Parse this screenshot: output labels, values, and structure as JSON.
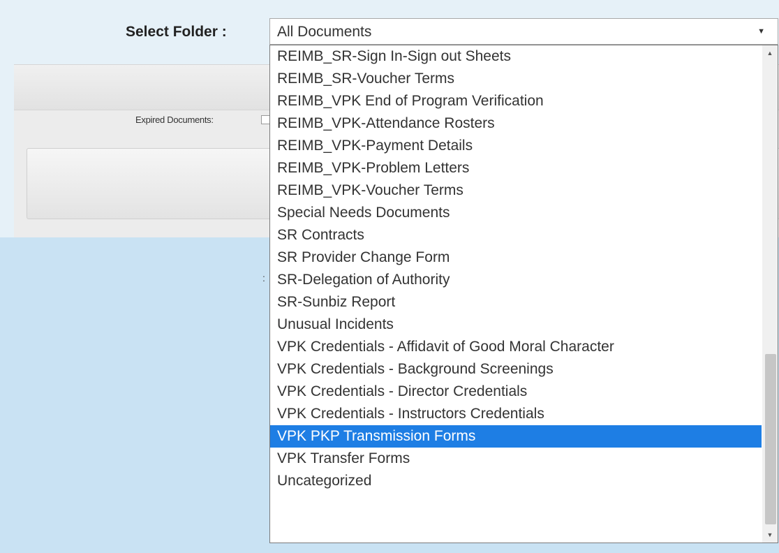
{
  "folder_selector": {
    "label": "Select Folder :",
    "value": "All Documents",
    "options": [
      "REIMB_SR-Sign In-Sign out Sheets",
      "REIMB_SR-Voucher Terms",
      "REIMB_VPK End of Program Verification",
      "REIMB_VPK-Attendance Rosters",
      "REIMB_VPK-Payment Details",
      "REIMB_VPK-Problem Letters",
      "REIMB_VPK-Voucher Terms",
      "Special Needs Documents",
      "SR Contracts",
      "SR Provider Change Form",
      "SR-Delegation of Authority",
      "SR-Sunbiz Report",
      "Unusual Incidents",
      "VPK Credentials - Affidavit of Good Moral Character",
      "VPK Credentials - Background Screenings",
      "VPK Credentials - Director Credentials",
      "VPK Credentials - Instructors Credentials",
      "VPK PKP Transmission Forms",
      "VPK Transfer Forms",
      "Uncategorized"
    ],
    "highlighted_option": "VPK PKP Transmission Forms"
  },
  "filters": {
    "expired_documents_label": "Expired Documents:"
  },
  "background_text": ":",
  "icons": {
    "dropdown_arrow": "chevron-down-icon",
    "scroll_up": "scroll-up-arrow-icon",
    "scroll_down": "scroll-down-arrow-icon"
  },
  "colors": {
    "highlight": "#1e7ee4",
    "page_background": "#c9e2f3"
  }
}
